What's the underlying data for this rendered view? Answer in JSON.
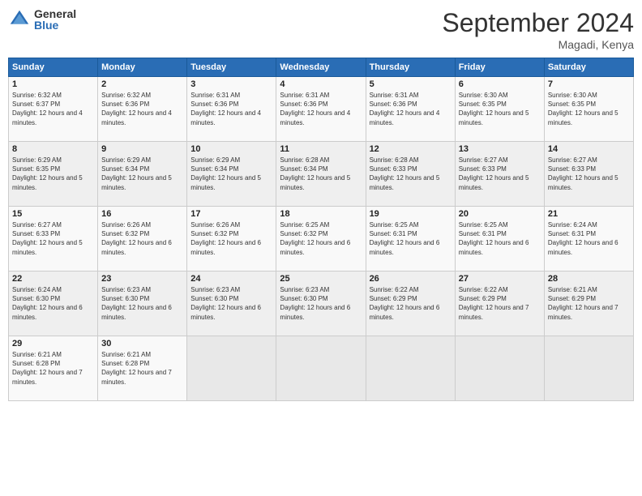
{
  "header": {
    "logo_general": "General",
    "logo_blue": "Blue",
    "month_title": "September 2024",
    "subtitle": "Magadi, Kenya"
  },
  "days_of_week": [
    "Sunday",
    "Monday",
    "Tuesday",
    "Wednesday",
    "Thursday",
    "Friday",
    "Saturday"
  ],
  "weeks": [
    [
      {
        "day": 1,
        "sunrise": "6:32 AM",
        "sunset": "6:37 PM",
        "daylight": "12 hours and 4 minutes."
      },
      {
        "day": 2,
        "sunrise": "6:32 AM",
        "sunset": "6:36 PM",
        "daylight": "12 hours and 4 minutes."
      },
      {
        "day": 3,
        "sunrise": "6:31 AM",
        "sunset": "6:36 PM",
        "daylight": "12 hours and 4 minutes."
      },
      {
        "day": 4,
        "sunrise": "6:31 AM",
        "sunset": "6:36 PM",
        "daylight": "12 hours and 4 minutes."
      },
      {
        "day": 5,
        "sunrise": "6:31 AM",
        "sunset": "6:36 PM",
        "daylight": "12 hours and 4 minutes."
      },
      {
        "day": 6,
        "sunrise": "6:30 AM",
        "sunset": "6:35 PM",
        "daylight": "12 hours and 5 minutes."
      },
      {
        "day": 7,
        "sunrise": "6:30 AM",
        "sunset": "6:35 PM",
        "daylight": "12 hours and 5 minutes."
      }
    ],
    [
      {
        "day": 8,
        "sunrise": "6:29 AM",
        "sunset": "6:35 PM",
        "daylight": "12 hours and 5 minutes."
      },
      {
        "day": 9,
        "sunrise": "6:29 AM",
        "sunset": "6:34 PM",
        "daylight": "12 hours and 5 minutes."
      },
      {
        "day": 10,
        "sunrise": "6:29 AM",
        "sunset": "6:34 PM",
        "daylight": "12 hours and 5 minutes."
      },
      {
        "day": 11,
        "sunrise": "6:28 AM",
        "sunset": "6:34 PM",
        "daylight": "12 hours and 5 minutes."
      },
      {
        "day": 12,
        "sunrise": "6:28 AM",
        "sunset": "6:33 PM",
        "daylight": "12 hours and 5 minutes."
      },
      {
        "day": 13,
        "sunrise": "6:27 AM",
        "sunset": "6:33 PM",
        "daylight": "12 hours and 5 minutes."
      },
      {
        "day": 14,
        "sunrise": "6:27 AM",
        "sunset": "6:33 PM",
        "daylight": "12 hours and 5 minutes."
      }
    ],
    [
      {
        "day": 15,
        "sunrise": "6:27 AM",
        "sunset": "6:33 PM",
        "daylight": "12 hours and 5 minutes."
      },
      {
        "day": 16,
        "sunrise": "6:26 AM",
        "sunset": "6:32 PM",
        "daylight": "12 hours and 6 minutes."
      },
      {
        "day": 17,
        "sunrise": "6:26 AM",
        "sunset": "6:32 PM",
        "daylight": "12 hours and 6 minutes."
      },
      {
        "day": 18,
        "sunrise": "6:25 AM",
        "sunset": "6:32 PM",
        "daylight": "12 hours and 6 minutes."
      },
      {
        "day": 19,
        "sunrise": "6:25 AM",
        "sunset": "6:31 PM",
        "daylight": "12 hours and 6 minutes."
      },
      {
        "day": 20,
        "sunrise": "6:25 AM",
        "sunset": "6:31 PM",
        "daylight": "12 hours and 6 minutes."
      },
      {
        "day": 21,
        "sunrise": "6:24 AM",
        "sunset": "6:31 PM",
        "daylight": "12 hours and 6 minutes."
      }
    ],
    [
      {
        "day": 22,
        "sunrise": "6:24 AM",
        "sunset": "6:30 PM",
        "daylight": "12 hours and 6 minutes."
      },
      {
        "day": 23,
        "sunrise": "6:23 AM",
        "sunset": "6:30 PM",
        "daylight": "12 hours and 6 minutes."
      },
      {
        "day": 24,
        "sunrise": "6:23 AM",
        "sunset": "6:30 PM",
        "daylight": "12 hours and 6 minutes."
      },
      {
        "day": 25,
        "sunrise": "6:23 AM",
        "sunset": "6:30 PM",
        "daylight": "12 hours and 6 minutes."
      },
      {
        "day": 26,
        "sunrise": "6:22 AM",
        "sunset": "6:29 PM",
        "daylight": "12 hours and 6 minutes."
      },
      {
        "day": 27,
        "sunrise": "6:22 AM",
        "sunset": "6:29 PM",
        "daylight": "12 hours and 7 minutes."
      },
      {
        "day": 28,
        "sunrise": "6:21 AM",
        "sunset": "6:29 PM",
        "daylight": "12 hours and 7 minutes."
      }
    ],
    [
      {
        "day": 29,
        "sunrise": "6:21 AM",
        "sunset": "6:28 PM",
        "daylight": "12 hours and 7 minutes."
      },
      {
        "day": 30,
        "sunrise": "6:21 AM",
        "sunset": "6:28 PM",
        "daylight": "12 hours and 7 minutes."
      },
      null,
      null,
      null,
      null,
      null
    ]
  ]
}
